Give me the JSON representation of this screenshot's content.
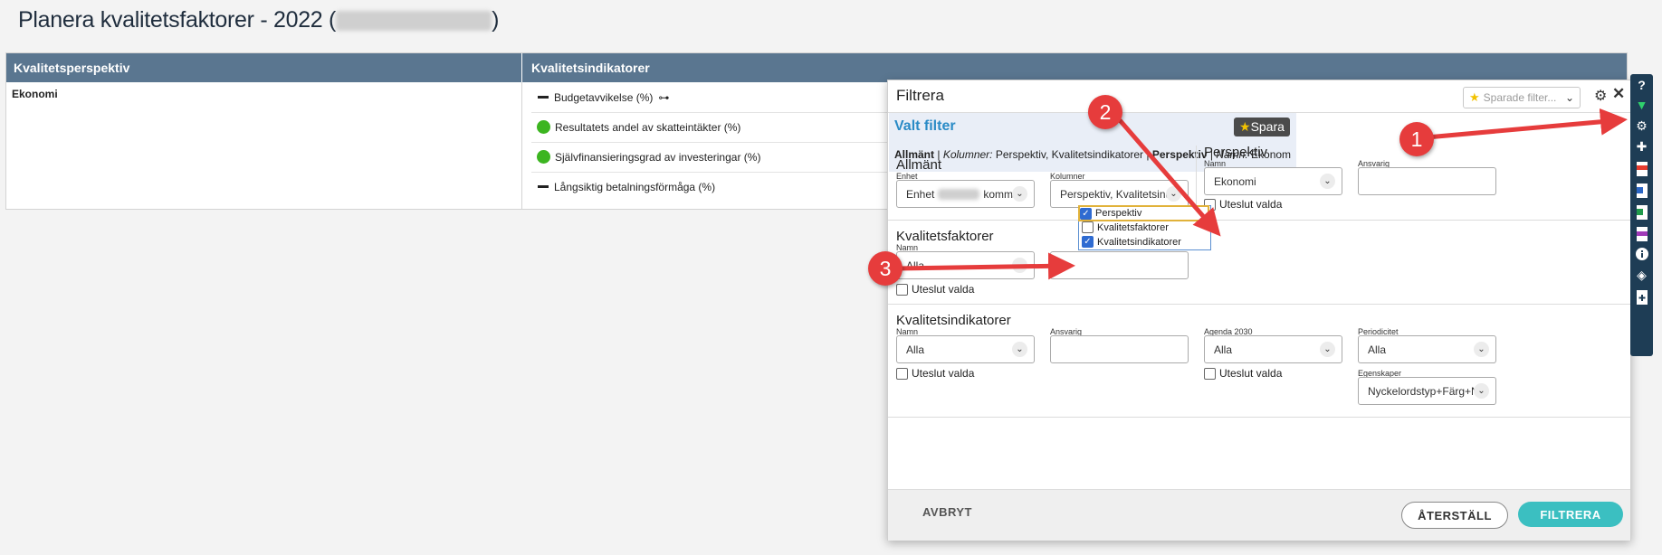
{
  "page": {
    "title": "Planera kvalitetsfaktorer - 2022 (",
    "title_end": ")"
  },
  "table": {
    "headers": [
      "Kvalitetsperspektiv",
      "Kvalitetsindikatorer"
    ],
    "perspective": "Ekonomi",
    "indicators": [
      {
        "label": "Budgetavvikelse (%)",
        "status": "dash"
      },
      {
        "label": "Resultatets andel av skatteintäkter (%)",
        "status": "green"
      },
      {
        "label": "Självfinansieringsgrad av investeringar (%)",
        "status": "green"
      },
      {
        "label": "Långsiktig betalningsförmåga (%)",
        "status": "dash"
      }
    ]
  },
  "dialog": {
    "title": "Filtrera",
    "saved_filters_placeholder": "Sparade filter...",
    "valt_filter": {
      "title": "Valt filter",
      "save_label": "Spara",
      "summary_general": "Allmänt",
      "summary_cols_key": "Kolumner:",
      "summary_cols_val": "Perspektiv, Kvalitetsindikatorer",
      "summary_persp": "Perspektiv",
      "summary_name_key": "Namn:",
      "summary_name_val": "Ekonomi"
    },
    "allmant": {
      "heading": "Allmänt",
      "enhet_label": "Enhet",
      "enhet_value_a": "Enhet",
      "enhet_value_b": "kommun",
      "kolumner_label": "Kolumner",
      "kolumner_value": "Perspektiv, Kvalitetsindi"
    },
    "kolumner_options": [
      {
        "label": "Perspektiv",
        "checked": true
      },
      {
        "label": "Kvalitetsfaktorer",
        "checked": false
      },
      {
        "label": "Kvalitetsindikatorer",
        "checked": true
      }
    ],
    "perspektiv": {
      "heading": "Perspektiv",
      "namn_label": "Namn",
      "namn_value": "Ekonomi",
      "ansvarig_label": "Ansvarig",
      "exclude_label": "Uteslut valda"
    },
    "kvalitetsfaktorer": {
      "heading": "Kvalitetsfaktorer",
      "namn_label": "Namn",
      "namn_value": "Alla",
      "exclude_label": "Uteslut valda"
    },
    "kvalitetsindikatorer": {
      "heading": "Kvalitetsindikatorer",
      "namn_label": "Namn",
      "namn_value": "Alla",
      "ansvarig_label": "Ansvarig",
      "agenda_label": "Agenda 2030",
      "agenda_value": "Alla",
      "periodicitet_label": "Periodicitet",
      "periodicitet_value": "Alla",
      "egenskaper_label": "Egenskaper",
      "egenskaper_value": "Nyckelordstyp+Färg+Na",
      "exclude_label": "Uteslut valda",
      "exclude_label_2": "Uteslut valda"
    },
    "footer": {
      "cancel": "AVBRYT",
      "reset": "ÅTERSTÄLL",
      "apply": "FILTRERA"
    }
  },
  "toolbar": [
    "help-icon",
    "filter-icon",
    "settings-icon",
    "puzzle-icon",
    "pdf-export-icon",
    "word-export-icon",
    "excel-export-icon",
    "web-export-icon",
    "info-icon",
    "superman-icon",
    "new-document-icon"
  ],
  "callouts": [
    "1",
    "2",
    "3"
  ],
  "colors": {
    "header": "#5a7690",
    "accent": "#2a8bc6",
    "primary_button": "#3bbfc1",
    "toolbar": "#1e3d55",
    "callout": "#e63c3c",
    "status_green": "#3cb520"
  }
}
